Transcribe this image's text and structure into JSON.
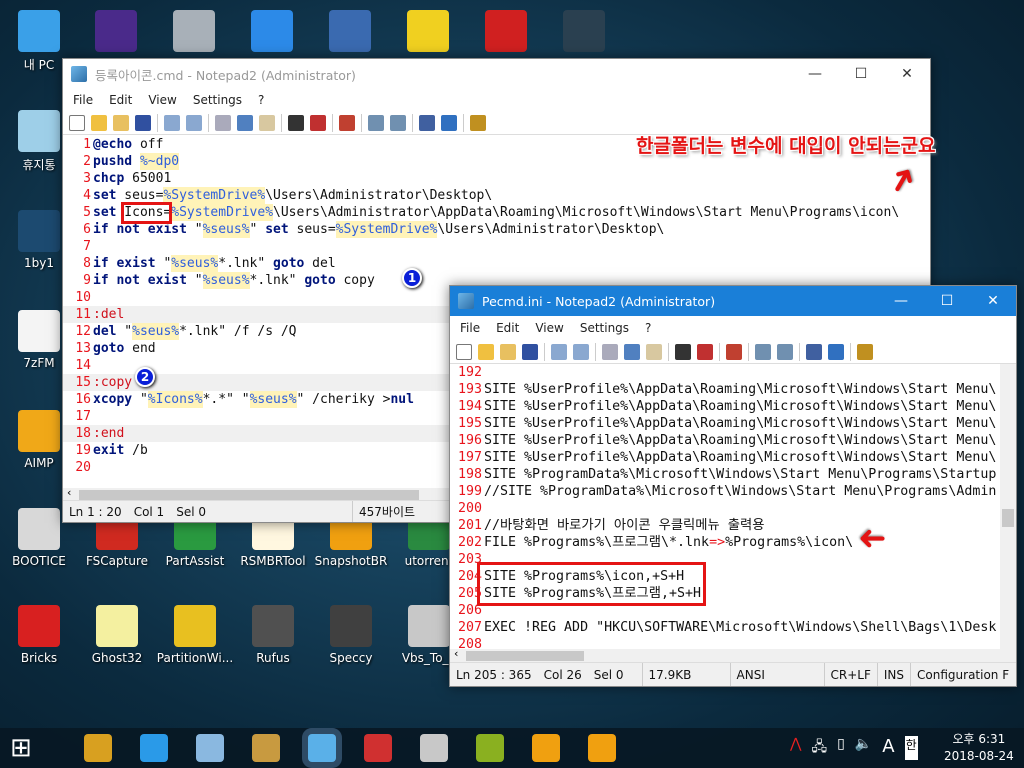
{
  "desktop": {
    "left_icons": [
      {
        "label": "내 PC",
        "color": "#3aa0e8"
      },
      {
        "label": "휴지통",
        "color": "#9ecfe8"
      },
      {
        "label": "1by1",
        "color": "#1c4a70"
      },
      {
        "label": "7zFM",
        "color": "#f4f4f4"
      },
      {
        "label": "AIMP",
        "color": "#f0a818"
      }
    ],
    "top_icons": [
      {
        "color": "#4a2a8a"
      },
      {
        "color": "#a8b0b8"
      },
      {
        "color": "#2c8ae8"
      },
      {
        "color": "#3a6ab0"
      },
      {
        "color": "#f0d020"
      },
      {
        "color": "#d02020"
      },
      {
        "color": "#2a4050"
      }
    ],
    "row1": [
      {
        "label": "BOOTICE",
        "color": "#d8d8d8"
      },
      {
        "label": "FSCapture",
        "color": "#d02a20"
      },
      {
        "label": "PartAssist",
        "color": "#2a9a40"
      },
      {
        "label": "RSMBRTool",
        "color": "#fff7e0"
      },
      {
        "label": "SnapshotBR",
        "color": "#f0a010"
      },
      {
        "label": "utorrent",
        "color": "#2a8a40"
      }
    ],
    "row2": [
      {
        "label": "Bricks",
        "color": "#d82020"
      },
      {
        "label": "Ghost32",
        "color": "#f4f0a0"
      },
      {
        "label": "PartitionWi...",
        "color": "#e8c020"
      },
      {
        "label": "Rufus",
        "color": "#505050"
      },
      {
        "label": "Speccy",
        "color": "#404040"
      },
      {
        "label": "Vbs_To_E",
        "color": "#c8c8c8"
      }
    ]
  },
  "win1": {
    "title": "등록아이콘.cmd - Notepad2 (Administrator)",
    "menu": [
      "File",
      "Edit",
      "View",
      "Settings",
      "?"
    ],
    "lines": [
      {
        "n": "1",
        "s": [
          [
            "kw",
            "@echo"
          ],
          [
            "tx",
            " off"
          ]
        ]
      },
      {
        "n": "2",
        "s": [
          [
            "kw",
            "pushd"
          ],
          [
            "tx",
            " "
          ],
          [
            "var",
            "%~dp0"
          ]
        ]
      },
      {
        "n": "3",
        "s": [
          [
            "kw",
            "chcp"
          ],
          [
            "tx",
            " 65001"
          ]
        ]
      },
      {
        "n": "4",
        "s": [
          [
            "kw",
            "set"
          ],
          [
            "tx",
            " seus="
          ],
          [
            "var",
            "%SystemDrive%"
          ],
          [
            "tx",
            "\\Users\\Administrator\\Desktop\\"
          ]
        ]
      },
      {
        "n": "5",
        "s": [
          [
            "kw",
            "set"
          ],
          [
            "tx",
            " Icons="
          ],
          [
            "var",
            "%SystemDrive%"
          ],
          [
            "tx",
            "\\Users\\Administrator\\AppData\\Roaming\\Microsoft\\Windows\\Start Menu\\Programs\\icon\\"
          ]
        ]
      },
      {
        "n": "6",
        "s": [
          [
            "kw",
            "if not exist"
          ],
          [
            "tx",
            " \""
          ],
          [
            "var",
            "%seus%"
          ],
          [
            "tx",
            "\" "
          ],
          [
            "kw",
            "set"
          ],
          [
            "tx",
            " seus="
          ],
          [
            "var",
            "%SystemDrive%"
          ],
          [
            "tx",
            "\\Users\\Administrator\\Desktop\\"
          ]
        ]
      },
      {
        "n": "7",
        "s": []
      },
      {
        "n": "8",
        "s": [
          [
            "kw",
            "if exist"
          ],
          [
            "tx",
            " \""
          ],
          [
            "var",
            "%seus%"
          ],
          [
            "tx",
            "*.lnk\" "
          ],
          [
            "kw",
            "goto"
          ],
          [
            "tx",
            " del"
          ]
        ]
      },
      {
        "n": "9",
        "s": [
          [
            "kw",
            "if not exist"
          ],
          [
            "tx",
            " \""
          ],
          [
            "var",
            "%seus%"
          ],
          [
            "tx",
            "*.lnk\" "
          ],
          [
            "kw",
            "goto"
          ],
          [
            "tx",
            " copy"
          ]
        ]
      },
      {
        "n": "10",
        "s": []
      },
      {
        "n": "11",
        "s": [
          [
            "lbl",
            ":del"
          ]
        ],
        "hl": true
      },
      {
        "n": "12",
        "s": [
          [
            "kw",
            "del"
          ],
          [
            "tx",
            " \""
          ],
          [
            "var",
            "%seus%"
          ],
          [
            "tx",
            "*.lnk\" /f /s /Q"
          ]
        ]
      },
      {
        "n": "13",
        "s": [
          [
            "kw",
            "goto"
          ],
          [
            "tx",
            " end"
          ]
        ]
      },
      {
        "n": "14",
        "s": []
      },
      {
        "n": "15",
        "s": [
          [
            "lbl",
            ":copy"
          ]
        ],
        "hl": true
      },
      {
        "n": "16",
        "s": [
          [
            "kw",
            "xcopy"
          ],
          [
            "tx",
            " \""
          ],
          [
            "var",
            "%Icons%"
          ],
          [
            "tx",
            "*.*\" \""
          ],
          [
            "var",
            "%seus%"
          ],
          [
            "tx",
            "\" /cheriky >"
          ],
          [
            "kw",
            "nul"
          ]
        ]
      },
      {
        "n": "17",
        "s": []
      },
      {
        "n": "18",
        "s": [
          [
            "lbl",
            ":end"
          ]
        ],
        "hl": true
      },
      {
        "n": "19",
        "s": [
          [
            "kw",
            "exit"
          ],
          [
            "tx",
            " /b"
          ]
        ]
      },
      {
        "n": "20",
        "s": []
      }
    ],
    "status": {
      "pos": "Ln 1 : 20",
      "col": "Col 1",
      "sel": "Sel 0",
      "size": "457바이트"
    }
  },
  "win2": {
    "title": "Pecmd.ini - Notepad2 (Administrator)",
    "menu": [
      "File",
      "Edit",
      "View",
      "Settings",
      "?"
    ],
    "lines": [
      {
        "n": "192",
        "s": []
      },
      {
        "n": "193",
        "s": [
          [
            "tx",
            "SITE %UserProfile%\\AppData\\Roaming\\Microsoft\\Windows\\Start Menu\\"
          ]
        ]
      },
      {
        "n": "194",
        "s": [
          [
            "tx",
            "SITE %UserProfile%\\AppData\\Roaming\\Microsoft\\Windows\\Start Menu\\"
          ]
        ]
      },
      {
        "n": "195",
        "s": [
          [
            "tx",
            "SITE %UserProfile%\\AppData\\Roaming\\Microsoft\\Windows\\Start Menu\\"
          ]
        ]
      },
      {
        "n": "196",
        "s": [
          [
            "tx",
            "SITE %UserProfile%\\AppData\\Roaming\\Microsoft\\Windows\\Start Menu\\"
          ]
        ]
      },
      {
        "n": "197",
        "s": [
          [
            "tx",
            "SITE %UserProfile%\\AppData\\Roaming\\Microsoft\\Windows\\Start Menu\\"
          ]
        ]
      },
      {
        "n": "198",
        "s": [
          [
            "tx",
            "SITE %ProgramData%\\Microsoft\\Windows\\Start Menu\\Programs\\Startup"
          ]
        ]
      },
      {
        "n": "199",
        "s": [
          [
            "tx",
            "//SITE %ProgramData%\\Microsoft\\Windows\\Start Menu\\Programs\\Admin"
          ]
        ]
      },
      {
        "n": "200",
        "s": []
      },
      {
        "n": "201",
        "s": [
          [
            "tx",
            "//바탕화면 바로가기 아이콘 우클릭메뉴 출력용"
          ]
        ]
      },
      {
        "n": "202",
        "s": [
          [
            "tx",
            "FILE %Programs%\\프로그램\\*.lnk"
          ],
          [
            "op",
            "=>"
          ],
          [
            "tx",
            "%Programs%\\icon\\"
          ]
        ]
      },
      {
        "n": "203",
        "s": []
      },
      {
        "n": "204",
        "s": [
          [
            "tx",
            "SITE %Programs%\\icon,+S+H"
          ]
        ]
      },
      {
        "n": "205",
        "s": [
          [
            "tx",
            "SITE %Programs%\\프로그램,+S+H"
          ]
        ]
      },
      {
        "n": "206",
        "s": []
      },
      {
        "n": "207",
        "s": [
          [
            "tx",
            "EXEC !REG ADD \"HKCU\\SOFTWARE\\Microsoft\\Windows\\Shell\\Bags\\1\\Desk"
          ]
        ]
      },
      {
        "n": "208",
        "s": []
      }
    ],
    "status": {
      "pos": "Ln 205 : 365",
      "col": "Col 26",
      "sel": "Sel 0",
      "size": "17.9KB",
      "enc": "ANSI",
      "eol": "CR+LF",
      "ins": "INS",
      "scheme": "Configuration F"
    }
  },
  "annotation": {
    "text": "한글폴더는 변수에 대입이 안되는군요",
    "badge1": "1",
    "badge2": "2",
    "color": "#e41414"
  },
  "taskbar": {
    "apps": [
      {
        "name": "start-button",
        "color": "#ffffff"
      },
      {
        "name": "imagine",
        "color": "#d8a020"
      },
      {
        "name": "internet-explorer",
        "color": "#2a9ae8"
      },
      {
        "name": "computer",
        "color": "#8ab8e0"
      },
      {
        "name": "installer",
        "color": "#c89a40"
      },
      {
        "name": "notepad2",
        "color": "#5ab0e8",
        "active": true
      },
      {
        "name": "partassist",
        "color": "#d03030"
      },
      {
        "name": "usb",
        "color": "#c8c8c8"
      },
      {
        "name": "aimp-olive",
        "color": "#8ab020"
      },
      {
        "name": "snapshotbr",
        "color": "#f0a010"
      },
      {
        "name": "power",
        "color": "#f0a010"
      }
    ],
    "time": "오후 6:31",
    "date": "2018-08-24",
    "ime": "한",
    "lang": "A"
  }
}
